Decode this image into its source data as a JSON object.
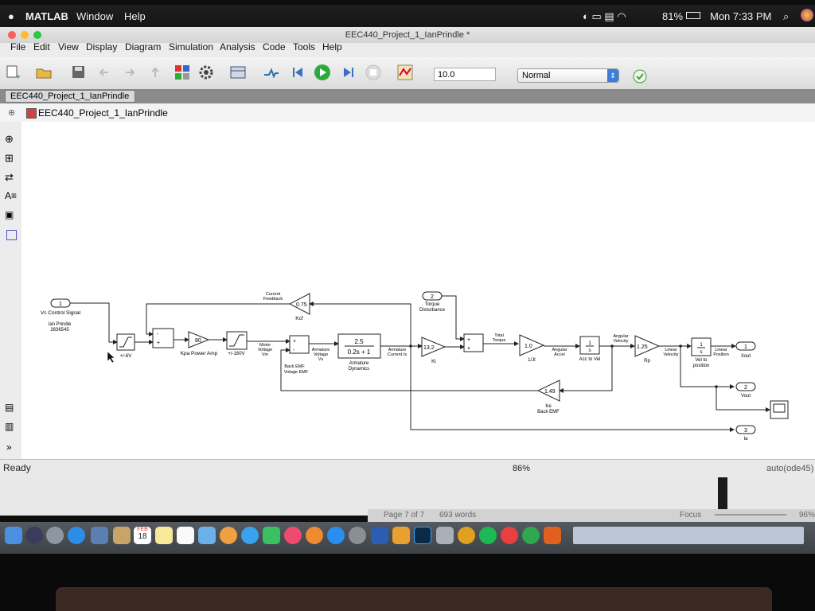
{
  "menubar": {
    "app": "MATLAB",
    "items": [
      "Window",
      "Help"
    ],
    "battery": "81%",
    "clock": "Mon 7:33 PM"
  },
  "window": {
    "title": "EEC440_Project_1_IanPrindle *"
  },
  "appmenu": {
    "items": [
      "File",
      "Edit",
      "View",
      "Display",
      "Diagram",
      "Simulation",
      "Analysis",
      "Code",
      "Tools",
      "Help"
    ]
  },
  "toolbar": {
    "stop_time": "10.0",
    "sim_mode": "Normal"
  },
  "tab": {
    "label": "EEC440_Project_1_IanPrindle"
  },
  "breadcrumb": {
    "label": "EEC440_Project_1_IanPrindle"
  },
  "status": {
    "left": "Ready",
    "zoom": "86%",
    "solver": "auto(ode45)"
  },
  "word_status": {
    "page": "Page 7 of 7",
    "words": "693 words",
    "focus": "Focus",
    "zoom": "96%"
  },
  "dock": {
    "calendar_day": "18",
    "calendar_month": "FEB"
  },
  "colors": {
    "accent": "#3a7ddd",
    "run_green": "#2eaa3c"
  },
  "diagram": {
    "in1": {
      "num": "1",
      "name": "Vc Control Signal",
      "author": "Ian Prindle",
      "id": "2636545"
    },
    "in2": {
      "num": "2",
      "name": "Torque",
      "name2": "Disturbance"
    },
    "sat1_label": "+/-6V",
    "kpa": {
      "value": "80",
      "label": "Kpa Power Amp"
    },
    "sat2_label": "+/-160V",
    "motor_label": [
      "Motor",
      "Voltage",
      "Vm"
    ],
    "kcf": {
      "value": "0.75",
      "label": "Kcf"
    },
    "current_feedback": [
      "Current",
      "Feedback"
    ],
    "backemf_label": [
      "Back EMF",
      "Votage EMF"
    ],
    "armature_voltage": [
      "Armature",
      "Voltage",
      "Vs"
    ],
    "tf": {
      "num": "2.5",
      "den": "0.2s + 1",
      "label": [
        "Armature",
        "Dynamics"
      ]
    },
    "armature_current": [
      "Armature",
      "Current Is"
    ],
    "kt": {
      "value": "13.2",
      "label": "Kt"
    },
    "total_torque": [
      "Total",
      "Torque"
    ],
    "inv_jt": {
      "value": "1.0",
      "label": "1/Jt"
    },
    "angular_accel": [
      "Angular",
      "Accel"
    ],
    "int1": {
      "num": "1",
      "den": "s",
      "label": "Acc to Vel"
    },
    "angular_velocity": [
      "Angular",
      "Velocity"
    ],
    "rp": {
      "value": "1.25",
      "label": "Rp"
    },
    "linear_velocity": [
      "Linear",
      "Velocity"
    ],
    "int2": {
      "num": "1",
      "den": "s",
      "label": [
        "Vel to",
        "position"
      ]
    },
    "linear_position": [
      "Linear",
      "Position"
    ],
    "ke": {
      "value": "1.49",
      "label": [
        "Ke",
        "Back EMF"
      ]
    },
    "out1": {
      "num": "1",
      "name": "Xout"
    },
    "out2": {
      "num": "2",
      "name": "Vout"
    },
    "out3": {
      "num": "3",
      "name": "Ia"
    }
  }
}
